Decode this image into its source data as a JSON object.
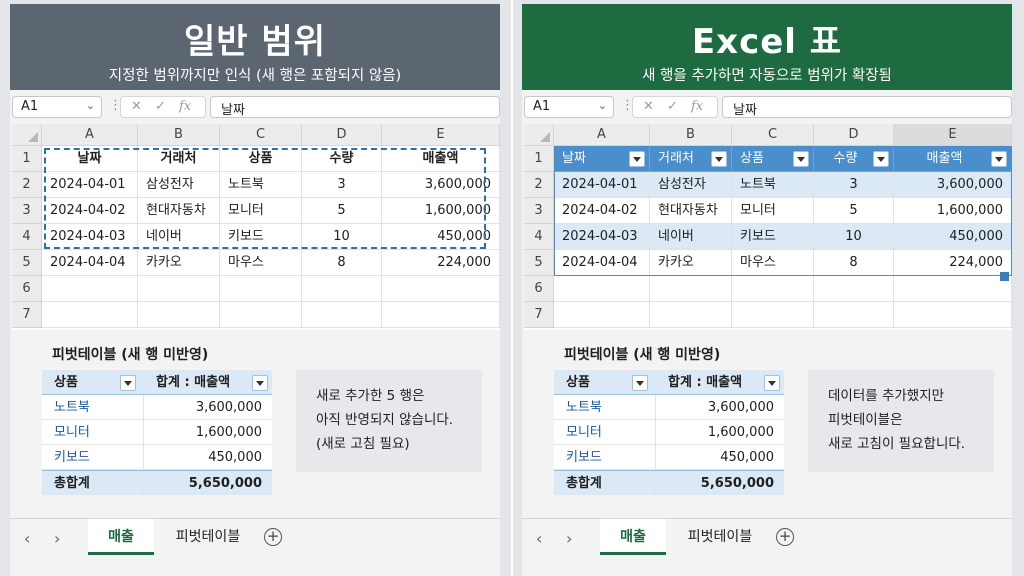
{
  "left": {
    "banner": {
      "title": "일반 범위",
      "subtitle": "지정한 범위까지만 인식 (새 행은 포함되지 않음)"
    },
    "formula_bar": {
      "name_box": "A1",
      "fx": "fx",
      "value": "날짜"
    },
    "columns": [
      "A",
      "B",
      "C",
      "D",
      "E"
    ],
    "rows": [
      "1",
      "2",
      "3",
      "4",
      "5",
      "6",
      "7"
    ],
    "header": [
      "날짜",
      "거래처",
      "상품",
      "수량",
      "매출액"
    ],
    "data": [
      [
        "2024-04-01",
        "삼성전자",
        "노트북",
        "3",
        "3,600,000"
      ],
      [
        "2024-04-02",
        "현대자동차",
        "모니터",
        "5",
        "1,600,000"
      ],
      [
        "2024-04-03",
        "네이버",
        "키보드",
        "10",
        "450,000"
      ],
      [
        "2024-04-04",
        "카카오",
        "마우스",
        "8",
        "224,000"
      ]
    ],
    "pivot_title": "피벗테이블 (새 행 미반영)",
    "pivot_header": [
      "상품",
      "합계 : 매출액"
    ],
    "pivot_rows": [
      [
        "노트북",
        "3,600,000"
      ],
      [
        "모니터",
        "1,600,000"
      ],
      [
        "키보드",
        "450,000"
      ]
    ],
    "pivot_total": [
      "총합계",
      "5,650,000"
    ],
    "note": [
      "새로 추가한 5 행은",
      "아직 반영되지 않습니다.",
      "(새로 고침 필요)"
    ],
    "tabs": [
      "매출",
      "피벗테이블"
    ]
  },
  "right": {
    "banner": {
      "title": "Excel 표",
      "subtitle": "새 행을 추가하면 자동으로 범위가 확장됨"
    },
    "formula_bar": {
      "name_box": "A1",
      "fx": "fx",
      "value": "날짜"
    },
    "columns": [
      "A",
      "B",
      "C",
      "D",
      "E"
    ],
    "rows": [
      "1",
      "2",
      "3",
      "4",
      "5",
      "6",
      "7"
    ],
    "header": [
      "날짜",
      "거래처",
      "상품",
      "수량",
      "매출액"
    ],
    "data": [
      [
        "2024-04-01",
        "삼성전자",
        "노트북",
        "3",
        "3,600,000"
      ],
      [
        "2024-04-02",
        "현대자동차",
        "모니터",
        "5",
        "1,600,000"
      ],
      [
        "2024-04-03",
        "네이버",
        "키보드",
        "10",
        "450,000"
      ],
      [
        "2024-04-04",
        "카카오",
        "마우스",
        "8",
        "224,000"
      ]
    ],
    "pivot_title": "피벗테이블 (새 행 미반영)",
    "pivot_header": [
      "상품",
      "합계 : 매출액"
    ],
    "pivot_rows": [
      [
        "노트북",
        "3,600,000"
      ],
      [
        "모니터",
        "1,600,000"
      ],
      [
        "키보드",
        "450,000"
      ]
    ],
    "pivot_total": [
      "총합계",
      "5,650,000"
    ],
    "note": [
      "데이터를 추가했지만",
      "피벗테이블은",
      "새로 고침이 필요합니다."
    ],
    "tabs": [
      "매출",
      "피벗테이블"
    ]
  },
  "colors": {
    "left_banner": "#5b6671",
    "right_banner": "#1e6b42",
    "table_header": "#4a8ecb",
    "table_band": "#dbe8f5",
    "range_outline": "#2f6fa6"
  },
  "icons": {
    "name_box_dropdown": "chevron-down-icon",
    "cancel": "x-icon",
    "confirm": "check-icon",
    "function": "fx-icon",
    "filter": "filter-dropdown-icon",
    "nav_prev": "chevron-left-icon",
    "nav_next": "chevron-right-icon",
    "add_sheet": "plus-circle-icon"
  }
}
